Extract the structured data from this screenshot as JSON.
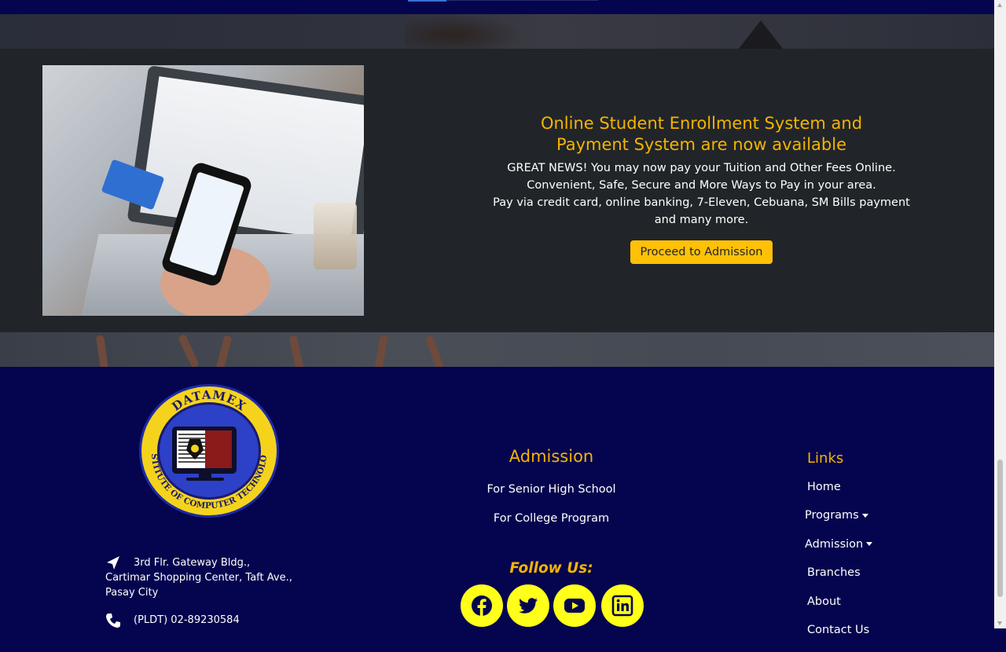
{
  "promo": {
    "title_line1": "Online Student Enrollment System and",
    "title_line2": "Payment System are now available",
    "body_line1": "GREAT NEWS! You may now pay your Tuition and Other Fees Online.",
    "body_line2": "Convenient, Safe, Secure and More Ways to Pay in your area.",
    "body_line3": "Pay via credit card, online banking, 7-Eleven, Cebuana, SM Bills payment",
    "body_line4": "and many more.",
    "button_label": "Proceed to Admission",
    "image_icon": "laptop-phone-payment-photo"
  },
  "logo": {
    "top_text": "DATAMEX",
    "ring_text": "INSTITUTE OF COMPUTER TECHNOLOGY",
    "colors": {
      "ring": "#f5d31c",
      "inner": "#2d40c8",
      "screen": "#8b1a1a"
    }
  },
  "contact": {
    "address_line1": "3rd Flr. Gateway Bldg.,",
    "address_line2": "Cartimar Shopping Center, Taft Ave.,",
    "address_line3": "Pasay City",
    "phone": "(PLDT) 02-89230584",
    "address_icon": "location-arrow-icon",
    "phone_icon": "phone-icon"
  },
  "admission": {
    "heading": "Admission",
    "items": [
      {
        "label": "For Senior High School"
      },
      {
        "label": "For College Program"
      }
    ]
  },
  "follow": {
    "heading": "Follow Us:",
    "socials": [
      {
        "name": "facebook-icon"
      },
      {
        "name": "twitter-icon"
      },
      {
        "name": "youtube-icon"
      },
      {
        "name": "linkedin-icon"
      }
    ]
  },
  "links": {
    "heading": "Links",
    "items": [
      {
        "label": "Home",
        "dropdown": false
      },
      {
        "label": "Programs",
        "dropdown": true
      },
      {
        "label": "Admission",
        "dropdown": true
      },
      {
        "label": "Branches",
        "dropdown": false
      },
      {
        "label": "About",
        "dropdown": false
      },
      {
        "label": "Contact Us",
        "dropdown": false
      }
    ]
  },
  "colors": {
    "accent": "#f5b400",
    "button": "#ffc107",
    "footer_bg": "#05054f",
    "promo_bg": "#212529",
    "social_bg": "#ffff19"
  }
}
